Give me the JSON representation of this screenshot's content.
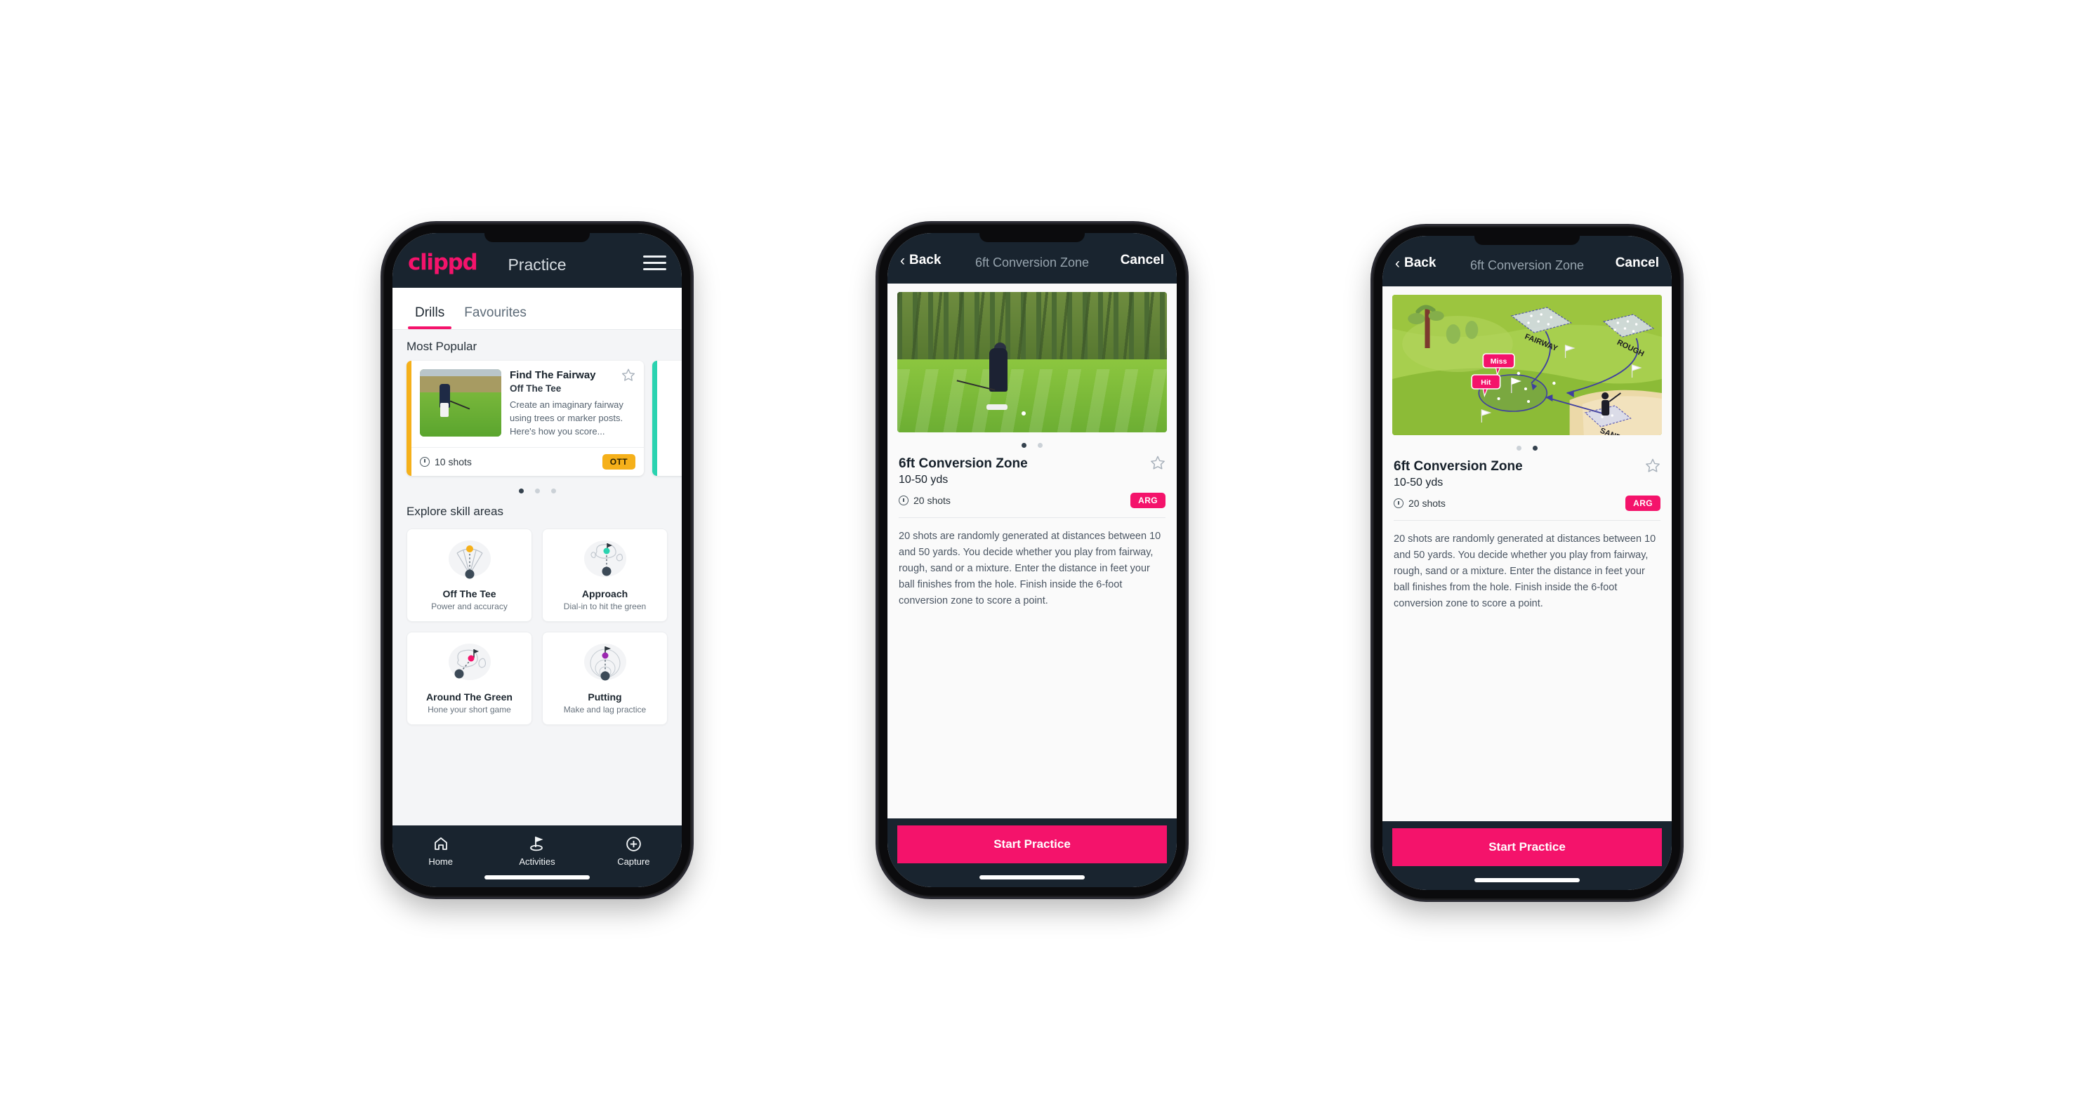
{
  "phone1": {
    "appbar": {
      "logo": "clippd",
      "title": "Practice",
      "menu_icon": "hamburger-menu-icon"
    },
    "tabs": [
      {
        "label": "Drills",
        "active": true
      },
      {
        "label": "Favourites",
        "active": false
      }
    ],
    "sections": {
      "most_popular": "Most Popular",
      "explore": "Explore skill areas"
    },
    "popular_card": {
      "title": "Find The Fairway",
      "subtitle": "Off The Tee",
      "description": "Create an imaginary fairway using trees or marker posts. Here's how you score...",
      "shots": "10 shots",
      "chip": "OTT",
      "chip_color": "#f5b01a",
      "accent_color": "#f5b01a",
      "next_card_accent": "#2ad3b0",
      "star_icon": "star-outline-icon"
    },
    "carousel_dots": {
      "count": 3,
      "active_index": 0
    },
    "skill_cards": [
      {
        "name": "Off The Tee",
        "desc": "Power and accuracy",
        "icon": "tee-fan-icon",
        "dot_color": "#f5b01a"
      },
      {
        "name": "Approach",
        "desc": "Dial-in to hit the green",
        "icon": "approach-green-icon",
        "dot_color": "#2ad3b0"
      },
      {
        "name": "Around The Green",
        "desc": "Hone your short game",
        "icon": "around-green-icon",
        "dot_color": "#f4136b"
      },
      {
        "name": "Putting",
        "desc": "Make and lag practice",
        "icon": "putting-rings-icon",
        "dot_color": "#9c27b0"
      }
    ],
    "bottom_nav": [
      {
        "label": "Home",
        "icon": "home-icon",
        "active": false
      },
      {
        "label": "Activities",
        "icon": "golf-flag-icon",
        "active": true
      },
      {
        "label": "Capture",
        "icon": "plus-circle-icon",
        "active": false
      }
    ]
  },
  "phone2": {
    "navbar": {
      "back": "Back",
      "title": "6ft Conversion Zone",
      "cancel": "Cancel",
      "back_icon": "chevron-left-icon"
    },
    "hero": {
      "type": "photo",
      "alt": "golfer-chipping-photo"
    },
    "carousel_dots": {
      "count": 2,
      "active_index": 0
    },
    "detail": {
      "title": "6ft Conversion Zone",
      "subtitle": "10-50 yds",
      "shots": "20 shots",
      "chip": "ARG",
      "chip_color": "#f4136b",
      "star_icon": "star-outline-icon",
      "description": "20 shots are randomly generated at distances between 10 and 50 yards. You decide whether you play from fairway, rough, sand or a mixture. Enter the distance in feet your ball finishes from the hole. Finish inside the 6-foot conversion zone to score a point."
    },
    "cta": {
      "label": "Start Practice",
      "color": "#f4136b"
    }
  },
  "phone3": {
    "navbar": {
      "back": "Back",
      "title": "6ft Conversion Zone",
      "cancel": "Cancel",
      "back_icon": "chevron-left-icon"
    },
    "hero": {
      "type": "illustration",
      "alt": "golf-course-diagram",
      "labels": [
        "FAIRWAY",
        "ROUGH",
        "SAND"
      ],
      "badges": [
        {
          "text": "Miss",
          "color": "#f4136b"
        },
        {
          "text": "Hit",
          "color": "#f4136b"
        }
      ]
    },
    "carousel_dots": {
      "count": 2,
      "active_index": 1
    },
    "detail": {
      "title": "6ft Conversion Zone",
      "subtitle": "10-50 yds",
      "shots": "20 shots",
      "chip": "ARG",
      "chip_color": "#f4136b",
      "star_icon": "star-outline-icon",
      "description": "20 shots are randomly generated at distances between 10 and 50 yards. You decide whether you play from fairway, rough, sand or a mixture. Enter the distance in feet your ball finishes from the hole. Finish inside the 6-foot conversion zone to score a point."
    },
    "cta": {
      "label": "Start Practice",
      "color": "#f4136b"
    }
  },
  "theme": {
    "brand_pink": "#f4136b",
    "dark_navy": "#19242f",
    "amber": "#f5b01a",
    "teal": "#2ad3b0",
    "page_bg": "#ffffff"
  }
}
